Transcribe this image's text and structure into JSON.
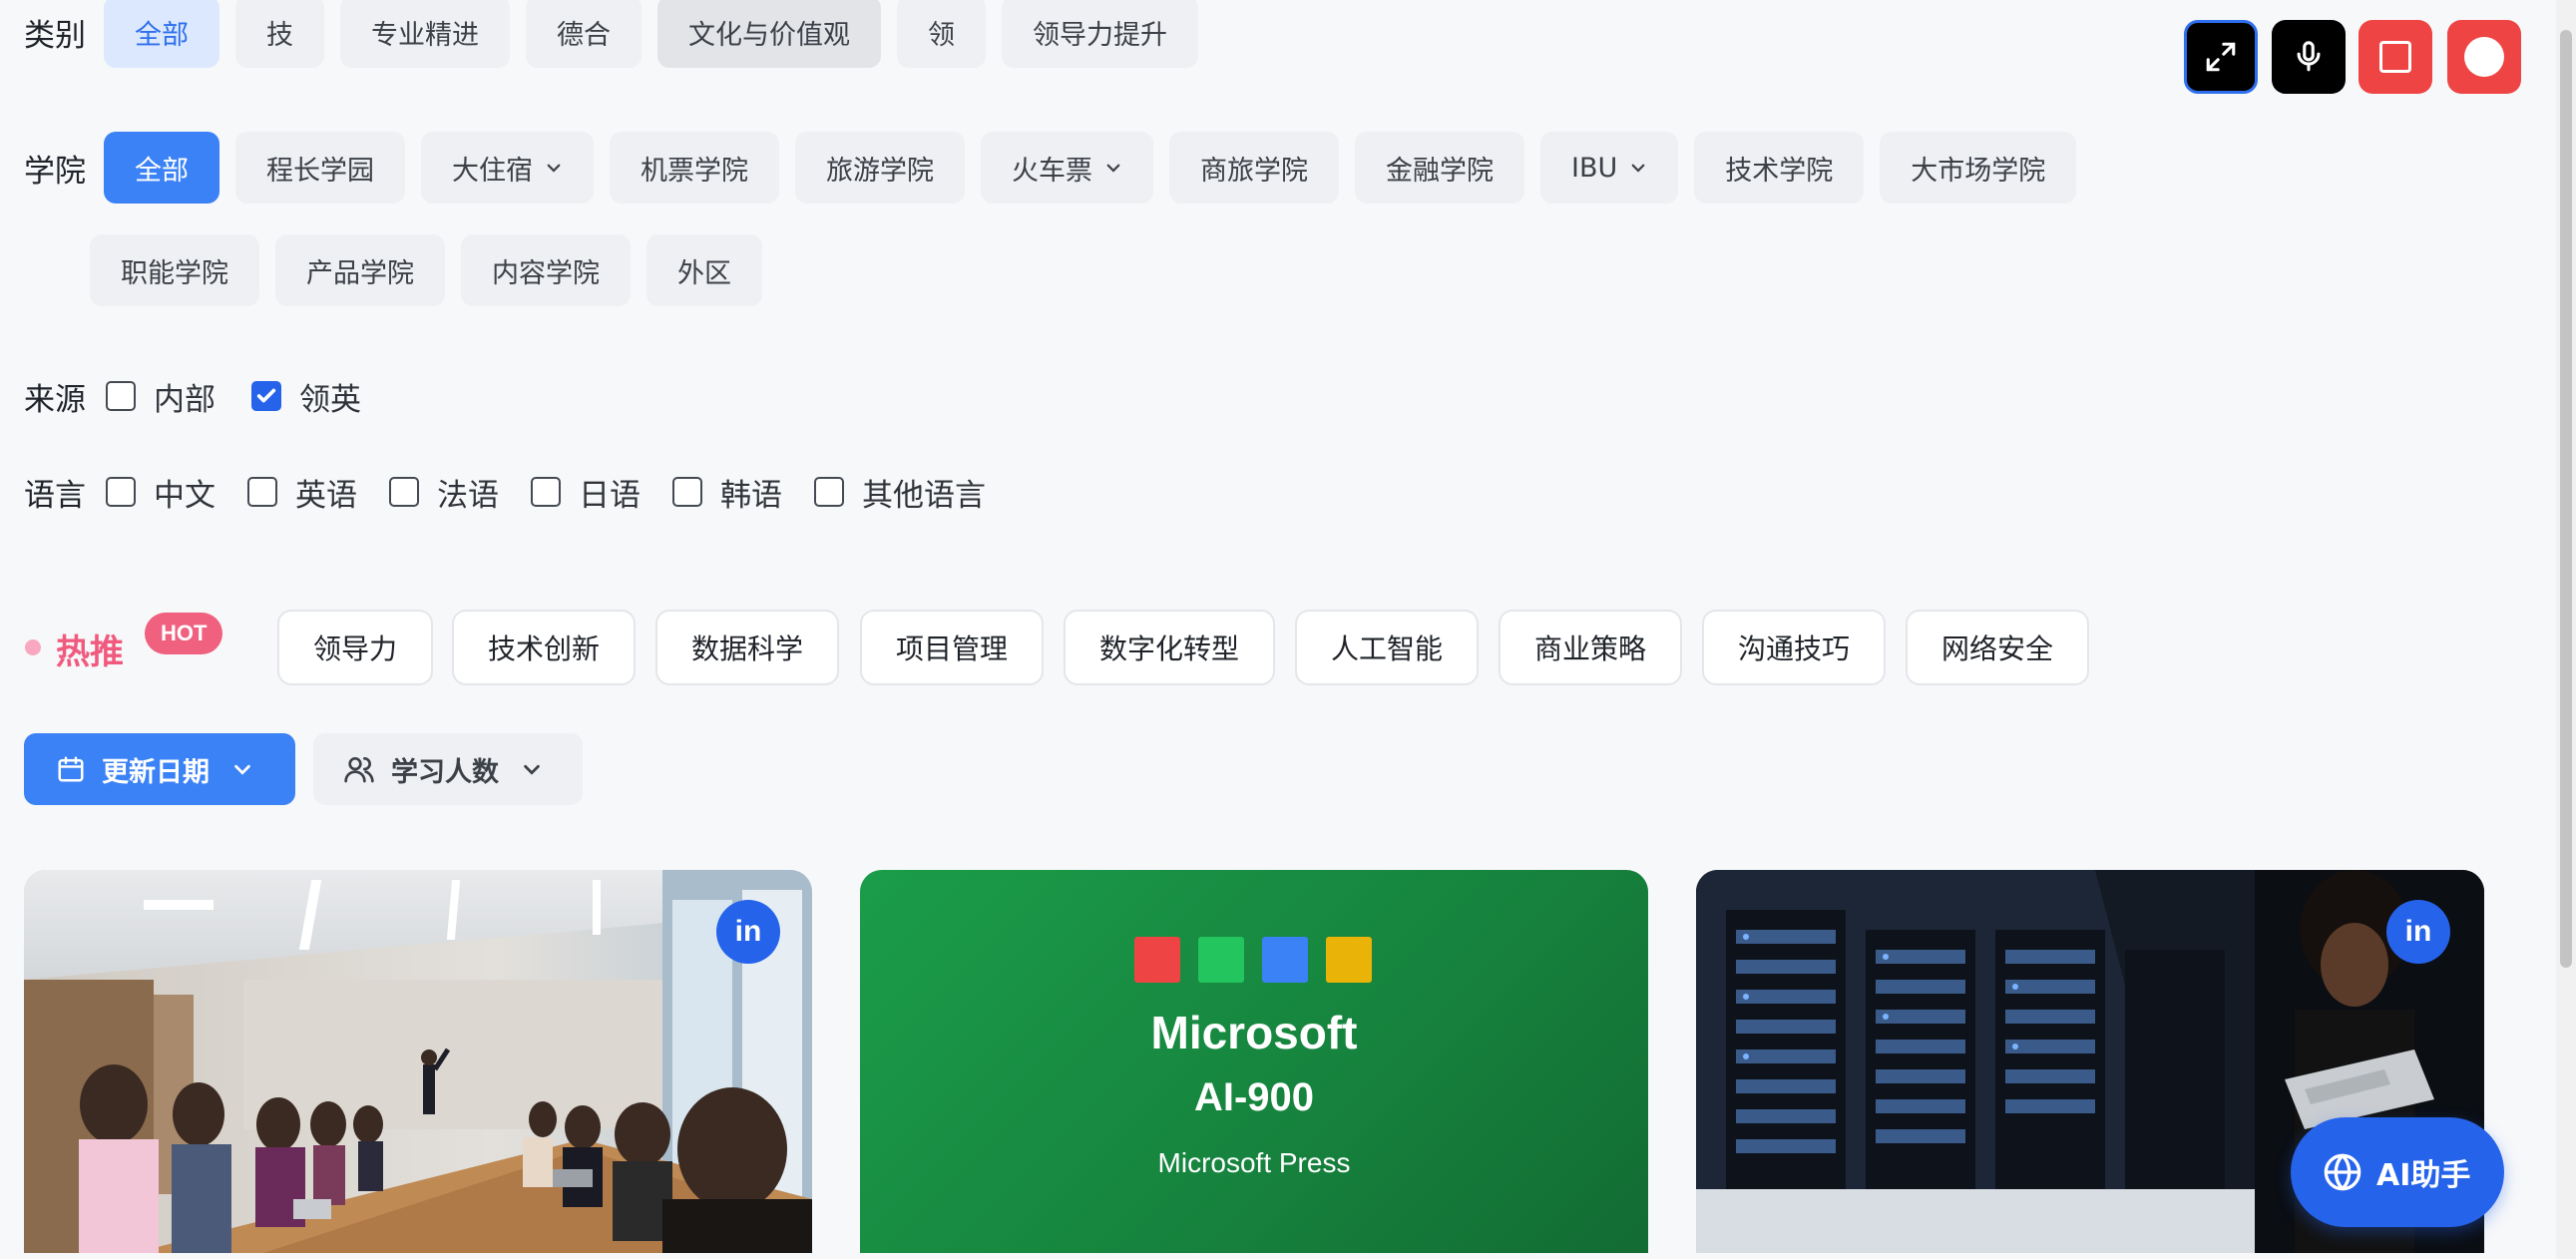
{
  "category": {
    "label": "类别",
    "items": [
      "全部",
      "技",
      "专业精进",
      "德合",
      "文化与价值观",
      "领",
      "领导力提升"
    ]
  },
  "college": {
    "label": "学院",
    "row1": [
      "全部",
      "程长学园",
      "大住宿",
      "机票学院",
      "旅游学院",
      "火车票",
      "商旅学院",
      "金融学院",
      "IBU",
      "技术学院",
      "大市场学院"
    ],
    "row2": [
      "职能学院",
      "产品学院",
      "内容学院",
      "外区"
    ]
  },
  "source": {
    "label": "来源",
    "options": [
      {
        "label": "内部",
        "checked": false
      },
      {
        "label": "领英",
        "checked": true
      }
    ]
  },
  "language": {
    "label": "语言",
    "options": [
      "中文",
      "英语",
      "法语",
      "日语",
      "韩语",
      "其他语言"
    ]
  },
  "hot": {
    "label": "热推",
    "badge": "HOT",
    "tags": [
      "领导力",
      "技术创新",
      "数据科学",
      "项目管理",
      "数字化转型",
      "人工智能",
      "商业策略",
      "沟通技巧",
      "网络安全"
    ]
  },
  "sort": {
    "update_date": "更新日期",
    "learners": "学习人数"
  },
  "cards": {
    "badge": "in",
    "ms": {
      "brand": "Microsoft",
      "code": "AI-900",
      "publisher": "Microsoft Press"
    }
  },
  "ai_assistant": "AI助手",
  "colors": {
    "accent": "#3b82f6",
    "hot": "#f05a7e",
    "record": "#ef4444",
    "ms_green": "#1a9a48"
  }
}
